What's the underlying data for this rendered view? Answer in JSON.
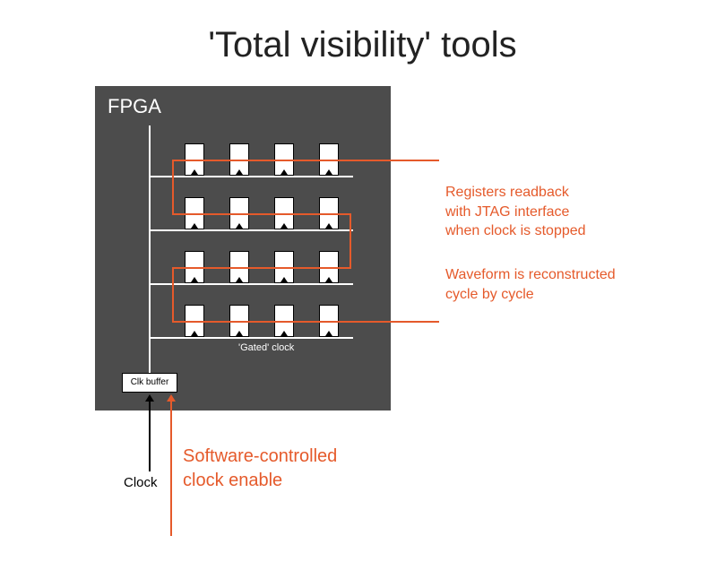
{
  "title": "'Total visibility' tools",
  "fpga": {
    "label": "FPGA",
    "gated_clock_label": "'Gated' clock",
    "clk_buffer_label": "Clk buffer"
  },
  "inputs": {
    "clock_label": "Clock",
    "sw_enable_line1": "Software-controlled",
    "sw_enable_line2": "clock enable"
  },
  "annotations": {
    "readback_line1": "Registers readback",
    "readback_line2": "with JTAG interface",
    "readback_line3": "when clock is stopped",
    "waveform_line1": "Waveform is reconstructed",
    "waveform_line2": "cycle by cycle"
  },
  "grid": {
    "rows": 4,
    "cols": 4
  }
}
